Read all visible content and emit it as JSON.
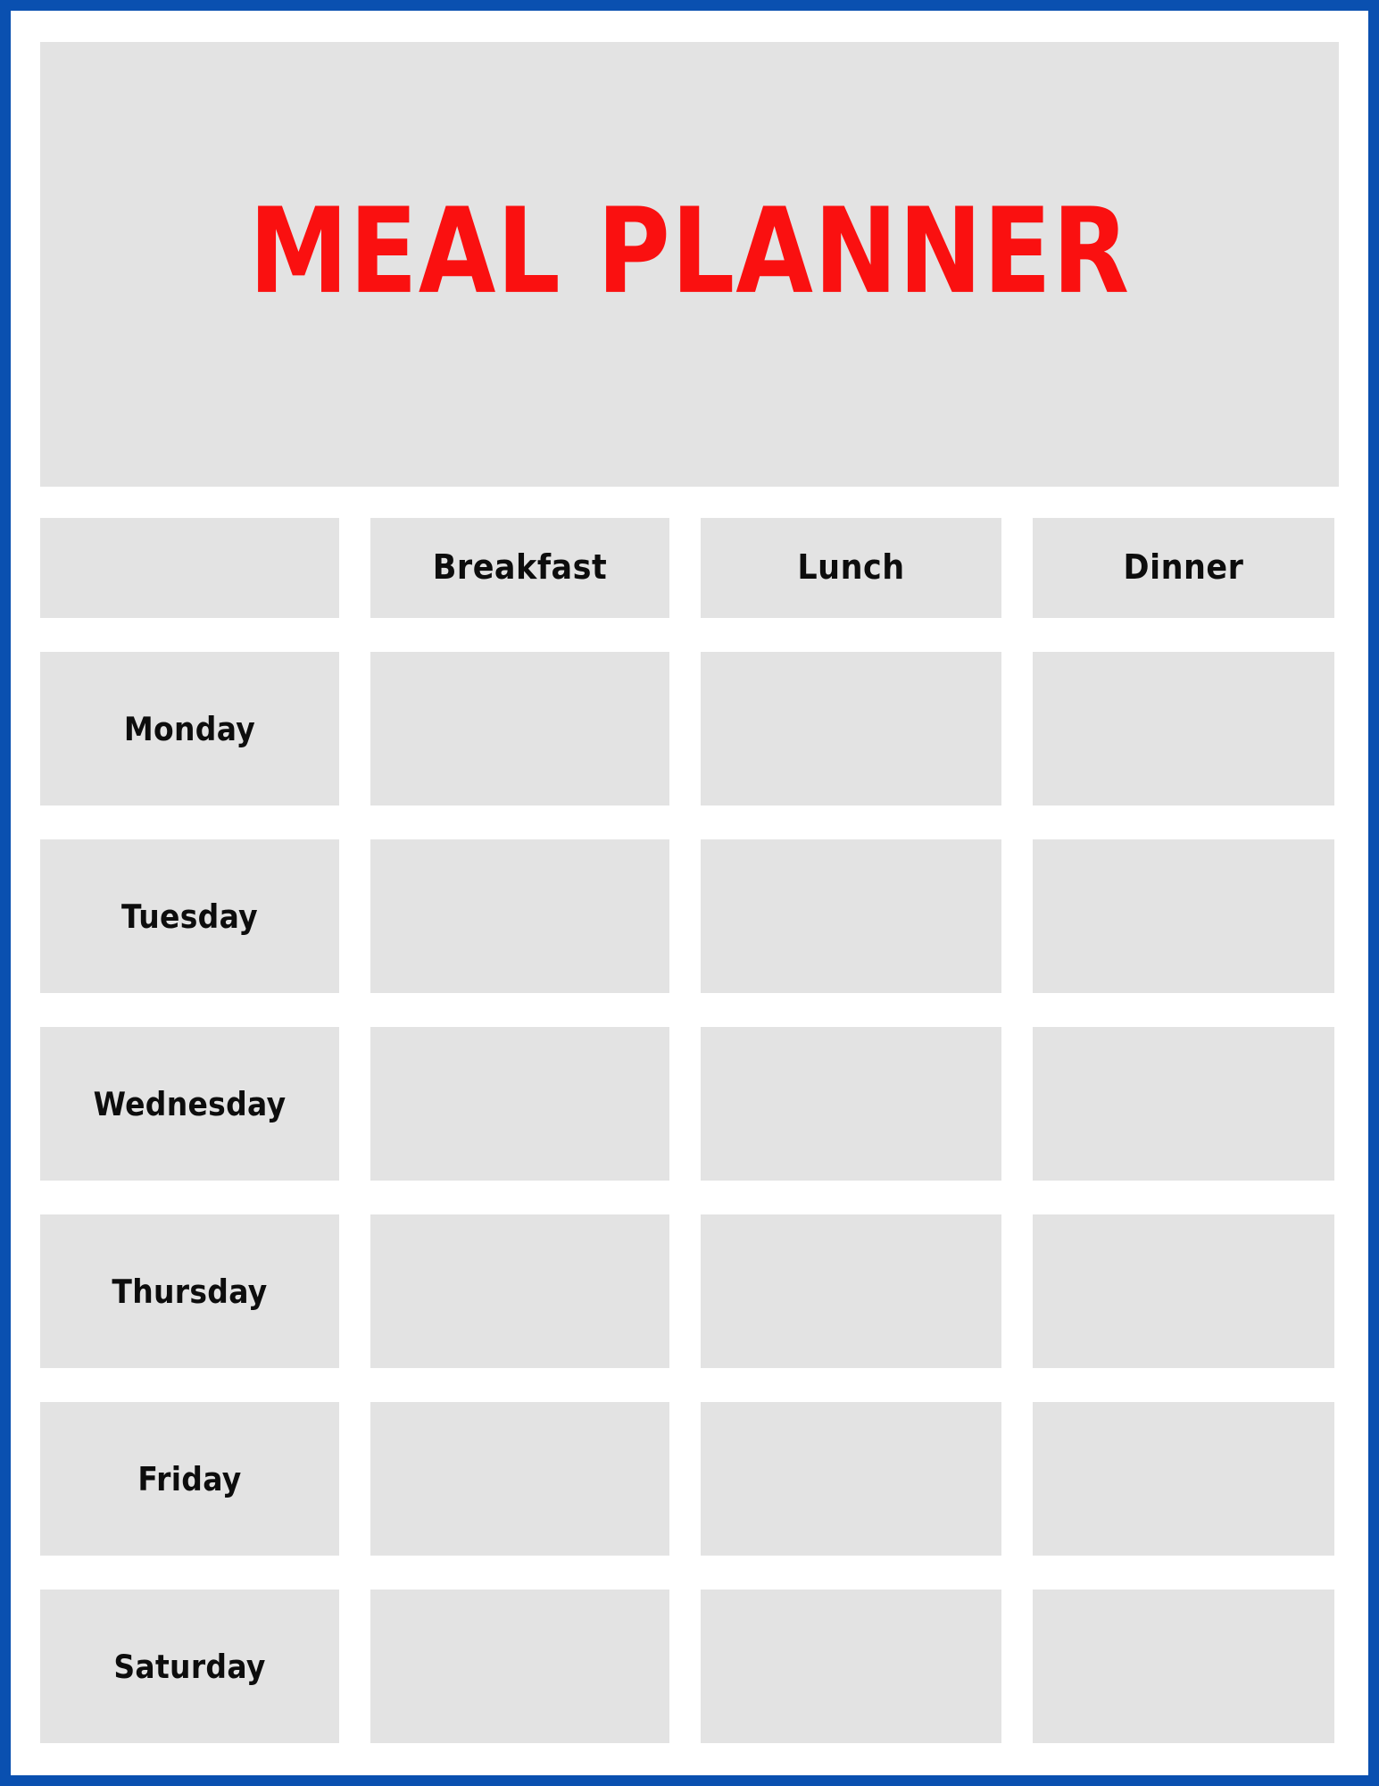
{
  "page": {
    "title": "MEAL PLANNER",
    "border_color": "#0a50b0",
    "cell_color": "#e3e3e3",
    "title_color": "#fa1010",
    "text_color": "#0d0d0d"
  },
  "table": {
    "corner_label": "",
    "columns": [
      {
        "label": "Breakfast"
      },
      {
        "label": "Lunch"
      },
      {
        "label": "Dinner"
      }
    ],
    "rows": [
      {
        "day": "Monday",
        "breakfast": "",
        "lunch": "",
        "dinner": ""
      },
      {
        "day": "Tuesday",
        "breakfast": "",
        "lunch": "",
        "dinner": ""
      },
      {
        "day": "Wednesday",
        "breakfast": "",
        "lunch": "",
        "dinner": ""
      },
      {
        "day": "Thursday",
        "breakfast": "",
        "lunch": "",
        "dinner": ""
      },
      {
        "day": "Friday",
        "breakfast": "",
        "lunch": "",
        "dinner": ""
      },
      {
        "day": "Saturday",
        "breakfast": "",
        "lunch": "",
        "dinner": ""
      }
    ]
  }
}
